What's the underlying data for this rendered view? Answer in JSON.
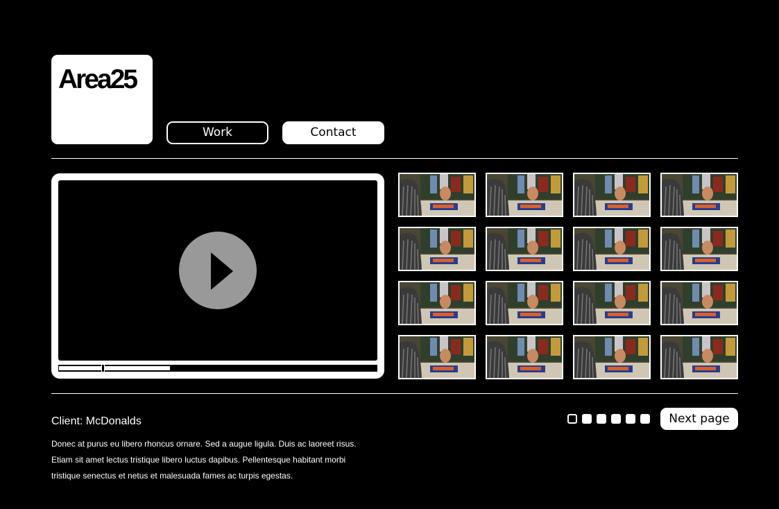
{
  "header": {
    "logo_text": "Area25",
    "nav": {
      "work_label": "Work",
      "contact_label": "Contact"
    }
  },
  "player": {
    "progress": 0.35,
    "position": 0.135
  },
  "thumbnails": {
    "rows": 4,
    "columns": 4
  },
  "project": {
    "client": "Client: McDonalds",
    "description_lines": [
      "Donec at purus eu libero rhoncus ornare. Sed a augue ligula. Duis ac laoreet risus.",
      "Etiam sit amet lectus tristique libero luctus dapibus. Pellentesque habitant morbi",
      "tristique senectus et netus et malesuada fames ac turpis egestas."
    ]
  },
  "pagination": {
    "page_count": 6,
    "current_page": 1,
    "next_label": "Next page"
  }
}
